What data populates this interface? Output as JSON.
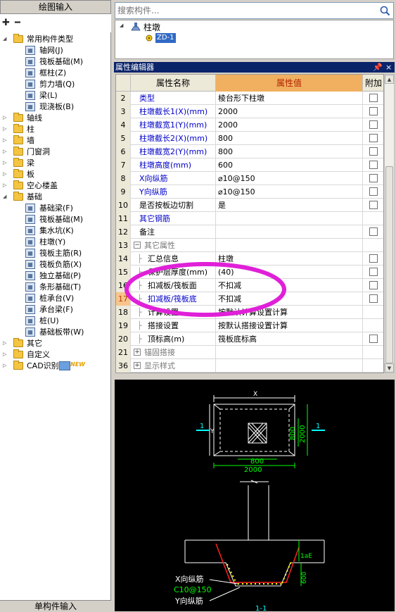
{
  "left_panel": {
    "header": "绘图输入",
    "footer": "单构件输入",
    "tree": [
      {
        "label": "常用构件类型",
        "type": "folder",
        "expanded": true,
        "level": 0
      },
      {
        "label": "轴网(J)",
        "type": "item",
        "icon": "axis-grid-icon",
        "level": 1
      },
      {
        "label": "筏板基础(M)",
        "type": "item",
        "icon": "raft-foundation-icon",
        "level": 1
      },
      {
        "label": "框柱(Z)",
        "type": "item",
        "icon": "frame-column-icon",
        "level": 1
      },
      {
        "label": "剪力墙(Q)",
        "type": "item",
        "icon": "shear-wall-icon",
        "level": 1
      },
      {
        "label": "梁(L)",
        "type": "item",
        "icon": "beam-icon",
        "level": 1
      },
      {
        "label": "现浇板(B)",
        "type": "item",
        "icon": "slab-icon",
        "level": 1
      },
      {
        "label": "轴线",
        "type": "folder",
        "expanded": false,
        "level": 0
      },
      {
        "label": "柱",
        "type": "folder",
        "expanded": false,
        "level": 0
      },
      {
        "label": "墙",
        "type": "folder",
        "expanded": false,
        "level": 0
      },
      {
        "label": "门窗洞",
        "type": "folder",
        "expanded": false,
        "level": 0
      },
      {
        "label": "梁",
        "type": "folder",
        "expanded": false,
        "level": 0
      },
      {
        "label": "板",
        "type": "folder",
        "expanded": false,
        "level": 0
      },
      {
        "label": "空心楼盖",
        "type": "folder",
        "expanded": false,
        "level": 0
      },
      {
        "label": "基础",
        "type": "folder",
        "expanded": true,
        "level": 0
      },
      {
        "label": "基础梁(F)",
        "type": "item",
        "icon": "foundation-beam-icon",
        "level": 1
      },
      {
        "label": "筏板基础(M)",
        "type": "item",
        "icon": "raft-foundation-icon",
        "level": 1
      },
      {
        "label": "集水坑(K)",
        "type": "item",
        "icon": "sump-pit-icon",
        "level": 1
      },
      {
        "label": "柱墩(Y)",
        "type": "item",
        "icon": "column-pier-icon",
        "level": 1
      },
      {
        "label": "筏板主筋(R)",
        "type": "item",
        "icon": "raft-main-rebar-icon",
        "level": 1
      },
      {
        "label": "筏板负筋(X)",
        "type": "item",
        "icon": "raft-negative-rebar-icon",
        "level": 1
      },
      {
        "label": "独立基础(P)",
        "type": "item",
        "icon": "isolated-footing-icon",
        "level": 1
      },
      {
        "label": "条形基础(T)",
        "type": "item",
        "icon": "strip-footing-icon",
        "level": 1
      },
      {
        "label": "桩承台(V)",
        "type": "item",
        "icon": "pile-cap-icon",
        "level": 1
      },
      {
        "label": "承台梁(F)",
        "type": "item",
        "icon": "cap-beam-icon",
        "level": 1
      },
      {
        "label": "桩(U)",
        "type": "item",
        "icon": "pile-icon",
        "level": 1
      },
      {
        "label": "基础板带(W)",
        "type": "item",
        "icon": "foundation-strip-icon",
        "level": 1
      },
      {
        "label": "其它",
        "type": "folder",
        "expanded": false,
        "level": 0
      },
      {
        "label": "自定义",
        "type": "folder",
        "expanded": false,
        "level": 0
      },
      {
        "label": "CAD识别",
        "type": "folder",
        "expanded": false,
        "level": 0,
        "badge": "NEW"
      }
    ]
  },
  "search": {
    "placeholder": "搜索构件..."
  },
  "component_tree": {
    "root": "柱墩",
    "child": "ZD-1"
  },
  "property_editor": {
    "title": "属性编辑器",
    "columns": {
      "name": "属性名称",
      "value": "属性值",
      "extra": "附加"
    },
    "rows": [
      {
        "num": "2",
        "name": "类型",
        "value": "棱台形下柱墩",
        "blue": true,
        "checkbox": true
      },
      {
        "num": "3",
        "name": "柱墩截长1(X)(mm)",
        "value": "2000",
        "blue": true,
        "checkbox": true
      },
      {
        "num": "4",
        "name": "柱墩截宽1(Y)(mm)",
        "value": "2000",
        "blue": true,
        "checkbox": true
      },
      {
        "num": "5",
        "name": "柱墩截长2(X)(mm)",
        "value": "800",
        "blue": true,
        "checkbox": true
      },
      {
        "num": "6",
        "name": "柱墩截宽2(Y)(mm)",
        "value": "800",
        "blue": true,
        "checkbox": true
      },
      {
        "num": "7",
        "name": "柱墩高度(mm)",
        "value": "600",
        "blue": true,
        "checkbox": true
      },
      {
        "num": "8",
        "name": "X向纵筋",
        "value": "⌀10@150",
        "blue": true,
        "checkbox": true
      },
      {
        "num": "9",
        "name": "Y向纵筋",
        "value": "⌀10@150",
        "blue": true,
        "checkbox": true
      },
      {
        "num": "10",
        "name": "是否按板边切割",
        "value": "是",
        "blue": false,
        "checkbox": true
      },
      {
        "num": "11",
        "name": "其它钢筋",
        "value": "",
        "blue": true,
        "checkbox": false
      },
      {
        "num": "12",
        "name": "备注",
        "value": "",
        "blue": false,
        "checkbox": true
      },
      {
        "num": "13",
        "name": "其它属性",
        "value": "",
        "group": true,
        "expanded": true,
        "checkbox": false
      },
      {
        "num": "14",
        "name": "汇总信息",
        "value": "柱墩",
        "indent": true,
        "checkbox": true
      },
      {
        "num": "15",
        "name": "保护层厚度(mm)",
        "value": "(40)",
        "indent": true,
        "checkbox": true
      },
      {
        "num": "16",
        "name": "扣减板/筏板面",
        "value": "不扣减",
        "indent": true,
        "checkbox": true
      },
      {
        "num": "17",
        "name": "扣减板/筏板底",
        "value": "不扣减",
        "indent": true,
        "checkbox": true,
        "selected": true
      },
      {
        "num": "18",
        "name": "计算设置",
        "value": "按默认计算设置计算",
        "indent": true,
        "checkbox": false
      },
      {
        "num": "19",
        "name": "搭接设置",
        "value": "按默认搭接设置计算",
        "indent": true,
        "checkbox": false
      },
      {
        "num": "20",
        "name": "顶标高(m)",
        "value": "筏板底标高",
        "indent": true,
        "checkbox": true
      },
      {
        "num": "21",
        "name": "锚固搭接",
        "value": "",
        "group": true,
        "expanded": false,
        "checkbox": false
      },
      {
        "num": "36",
        "name": "显示样式",
        "value": "",
        "group": true,
        "expanded": false,
        "checkbox": false
      }
    ]
  },
  "drawing": {
    "dim_x": "X",
    "dim_y": "Y",
    "dim_2000_top": "2000",
    "dim_800_h": "800",
    "dim_800_v": "800",
    "dim_2000_v": "2000",
    "section_mark": "1",
    "lae": "1aE",
    "dim_600": "600",
    "label_x_rebar": "X向纵筋",
    "label_rebar_spec": "C10@150",
    "label_y_rebar": "Y向纵筋",
    "section_title": "1-1"
  },
  "colors": {
    "title_bar": "#0a246a",
    "selected_row_num": "#f9c48c",
    "value_header": "#f0b060",
    "highlight_ellipse": "#e020d8",
    "drawing_bg": "#000000",
    "dim_green": "#00ff00",
    "section_cyan": "#00ffff",
    "rebar_red": "#ff2020",
    "rebar_yellow": "#ffff00"
  }
}
